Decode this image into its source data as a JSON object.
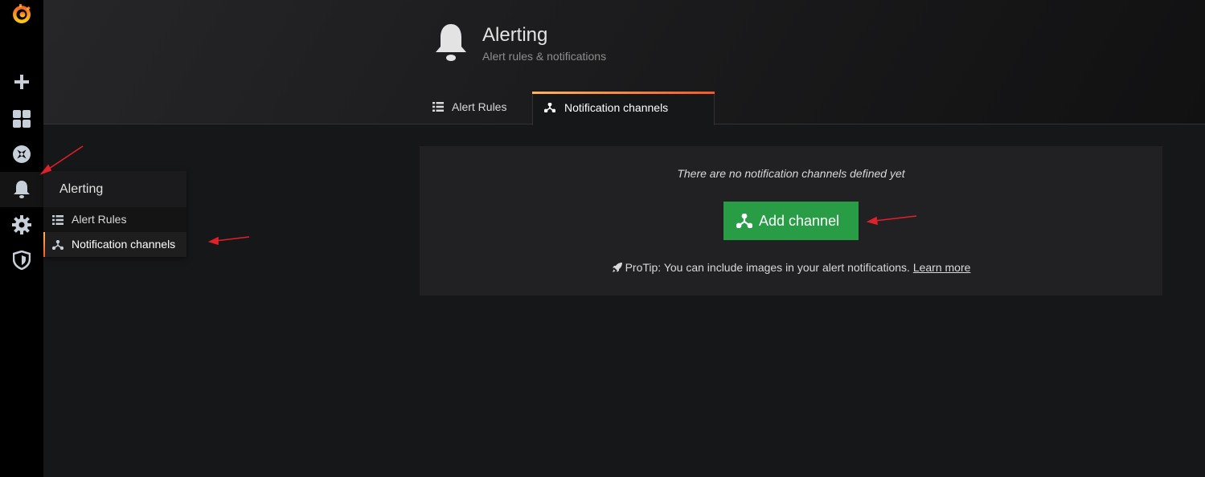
{
  "sidebar": {
    "items": [
      {
        "icon": "grafana-logo-icon"
      },
      {
        "icon": "plus-icon"
      },
      {
        "icon": "dashboards-icon"
      },
      {
        "icon": "explore-compass-icon"
      },
      {
        "icon": "bell-icon",
        "active": true
      },
      {
        "icon": "gear-icon"
      },
      {
        "icon": "shield-icon"
      }
    ]
  },
  "flyout": {
    "title": "Alerting",
    "items": [
      {
        "label": "Alert Rules",
        "icon": "list-icon"
      },
      {
        "label": "Notification channels",
        "icon": "channels-icon",
        "active": true
      }
    ]
  },
  "header": {
    "title": "Alerting",
    "subtitle": "Alert rules & notifications",
    "icon": "bell-icon"
  },
  "tabs": [
    {
      "label": "Alert Rules",
      "icon": "list-icon"
    },
    {
      "label": "Notification channels",
      "icon": "channels-icon",
      "active": true
    }
  ],
  "empty_state": {
    "message": "There are no notification channels defined yet",
    "button_label": "Add channel",
    "protip_text": "ProTip: You can include images in your alert notifications.",
    "protip_link": "Learn more"
  },
  "colors": {
    "accent_gradient_start": "#ffb357",
    "accent_gradient_end": "#f05a28",
    "button_green": "#299c46",
    "annotation_red": "#e0202a"
  }
}
